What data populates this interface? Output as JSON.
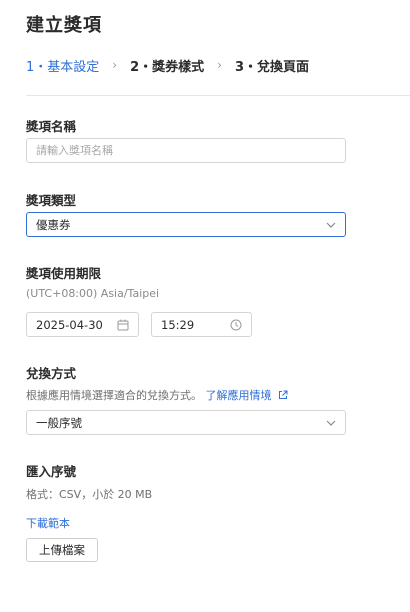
{
  "page": {
    "title": "建立獎項"
  },
  "steps": [
    {
      "label": "1・基本設定",
      "active": true
    },
    {
      "label": "2・獎券樣式",
      "active": false
    },
    {
      "label": "3・兌換頁面",
      "active": false
    }
  ],
  "form": {
    "name": {
      "label": "獎項名稱",
      "value": "",
      "placeholder": "請輸入獎項名稱"
    },
    "type": {
      "label": "獎項類型",
      "value": "優惠券"
    },
    "period": {
      "label": "獎項使用期限",
      "timezone": "(UTC+08:00) Asia/Taipei",
      "date": "2025-04-30",
      "time": "15:29"
    },
    "redeem": {
      "label": "兌換方式",
      "hint": "根據應用情境選擇適合的兌換方式。",
      "learn_more": "了解應用情境",
      "value": "一般序號"
    },
    "import": {
      "label": "匯入序號",
      "format_hint": "格式：CSV，小於 20 MB",
      "download_template": "下載範本",
      "upload_button": "上傳檔案"
    }
  },
  "colors": {
    "accent": "#2f6fd6",
    "border": "#d5d5d5",
    "muted_text": "#8a8a8a"
  },
  "icons": {
    "step_separator": "chevron-right-icon",
    "select_arrow": "chevron-down-icon",
    "date": "calendar-icon",
    "time": "clock-icon",
    "external": "external-link-icon"
  }
}
